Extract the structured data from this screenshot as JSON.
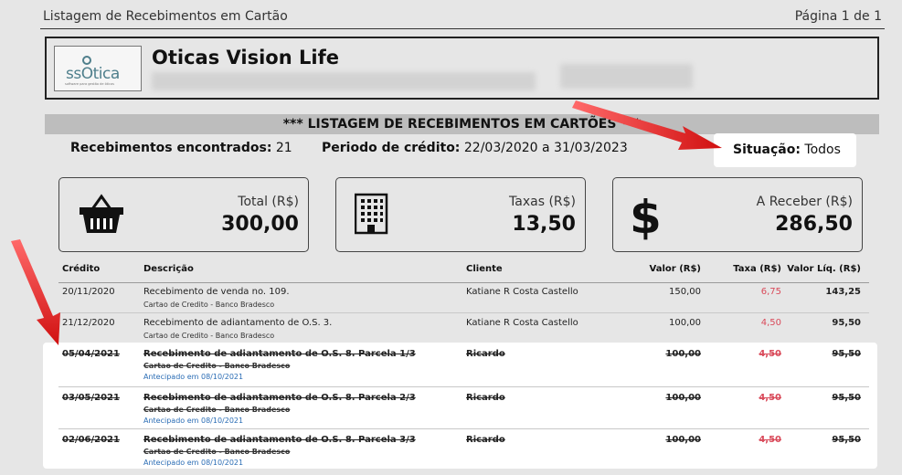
{
  "header": {
    "title": "Listagem de Recebimentos em Cartão",
    "page": "Página 1 de 1"
  },
  "company": {
    "logo_text": "ssOtica",
    "logo_sub": "software para gestão de óticas",
    "name": "Oticas Vision Life"
  },
  "banner": "*** LISTAGEM DE RECEBIMENTOS EM CARTÕES ***",
  "meta": {
    "found_label": "Recebimentos encontrados:",
    "found_value": "21",
    "period_label": "Periodo de crédito:",
    "period_value": "22/03/2020 a 31/03/2023",
    "status_label": "Situação:",
    "status_value": "Todos"
  },
  "cards": [
    {
      "label": "Total (R$)",
      "value": "300,00",
      "icon": "basket-icon"
    },
    {
      "label": "Taxas (R$)",
      "value": "13,50",
      "icon": "building-icon"
    },
    {
      "label": "A Receber (R$)",
      "value": "286,50",
      "icon": "dollar-icon"
    }
  ],
  "table": {
    "columns": [
      "Crédito",
      "Descrição",
      "Cliente",
      "Valor (R$)",
      "Taxa (R$)",
      "Valor Líq. (R$)"
    ],
    "rows": [
      {
        "date": "20/11/2020",
        "desc": "Recebimento de venda no. 109.",
        "sub": "Cartao de Credito - Banco Bradesco",
        "client": "Katiane R Costa Castello",
        "valor": "150,00",
        "taxa": "6,75",
        "liquido": "143,25"
      },
      {
        "date": "21/12/2020",
        "desc": "Recebimento de adiantamento de O.S. 3.",
        "sub": "Cartao de Credito - Banco Bradesco",
        "client": "Katiane R Costa Castello",
        "valor": "100,00",
        "taxa": "4,50",
        "liquido": "95,50"
      },
      {
        "date": "05/04/2021",
        "desc": "Recebimento de adiantamento de O.S. 8. Parcela 1/3",
        "sub": "Cartao de Credito - Banco Bradesco",
        "antecipado": "Antecipado em 08/10/2021",
        "client": "Ricardo",
        "valor": "100,00",
        "taxa": "4,50",
        "liquido": "95,50"
      },
      {
        "date": "03/05/2021",
        "desc": "Recebimento de adiantamento de O.S. 8. Parcela 2/3",
        "sub": "Cartao de Credito - Banco Bradesco",
        "antecipado": "Antecipado em 08/10/2021",
        "client": "Ricardo",
        "valor": "100,00",
        "taxa": "4,50",
        "liquido": "95,50"
      },
      {
        "date": "02/06/2021",
        "desc": "Recebimento de adiantamento de O.S. 8. Parcela 3/3",
        "sub": "Cartao de Credito - Banco Bradesco",
        "antecipado": "Antecipado em 08/10/2021",
        "client": "Ricardo",
        "valor": "100,00",
        "taxa": "4,50",
        "liquido": "95,50"
      }
    ]
  },
  "colors": {
    "dim": "#e6e6e6",
    "banner": "#bdbdbd",
    "taxa": "#d94a5a",
    "antecipado": "#2b6db5",
    "arrow": "#e02020"
  }
}
